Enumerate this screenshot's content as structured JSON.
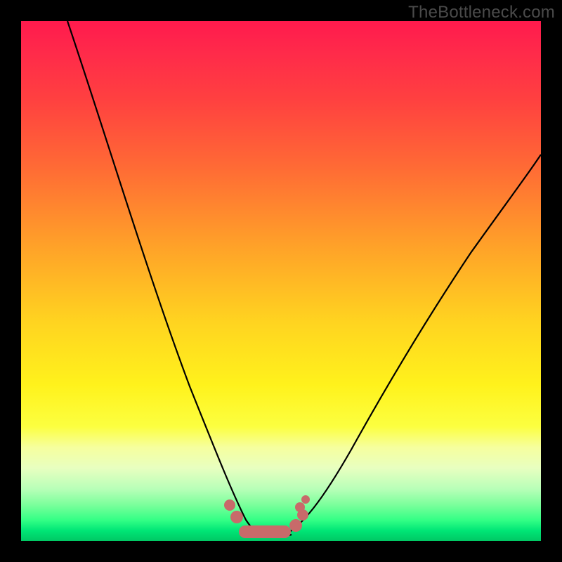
{
  "watermark": "TheBottleneck.com",
  "colors": {
    "background": "#000000",
    "curve": "#000000",
    "marker_fill": "#c86a6a",
    "marker_stroke": "#c86a6a",
    "gradient_top": "#ff1a4d",
    "gradient_bottom": "#00c864"
  },
  "chart_data": {
    "type": "line",
    "title": "",
    "xlabel": "",
    "ylabel": "",
    "xlim": [
      0,
      100
    ],
    "ylim": [
      0,
      100
    ],
    "grid": false,
    "series": [
      {
        "name": "left-curve",
        "x": [
          9,
          12,
          15,
          18,
          21,
          24,
          27,
          30,
          33,
          35,
          37,
          39,
          40.5,
          42,
          43.5,
          45
        ],
        "values": [
          100,
          88,
          76,
          64,
          53,
          43,
          34,
          26,
          19,
          14,
          10,
          6.5,
          4.5,
          3,
          2,
          1.5
        ]
      },
      {
        "name": "right-curve",
        "x": [
          50,
          52,
          55,
          58,
          62,
          66,
          70,
          75,
          80,
          85,
          90,
          95,
          100
        ],
        "values": [
          1.5,
          3,
          6,
          10,
          16,
          23,
          30,
          38,
          47,
          55,
          62,
          69,
          75
        ]
      }
    ],
    "flat_segment": {
      "x": [
        42,
        52
      ],
      "value": 1.2
    },
    "markers": {
      "x": [
        40,
        42.5,
        45,
        47.5,
        50,
        52,
        53.5,
        55
      ],
      "values": [
        5,
        2.5,
        1.2,
        1.2,
        1.2,
        1.4,
        3,
        6
      ],
      "style": "thick-rounded"
    }
  }
}
